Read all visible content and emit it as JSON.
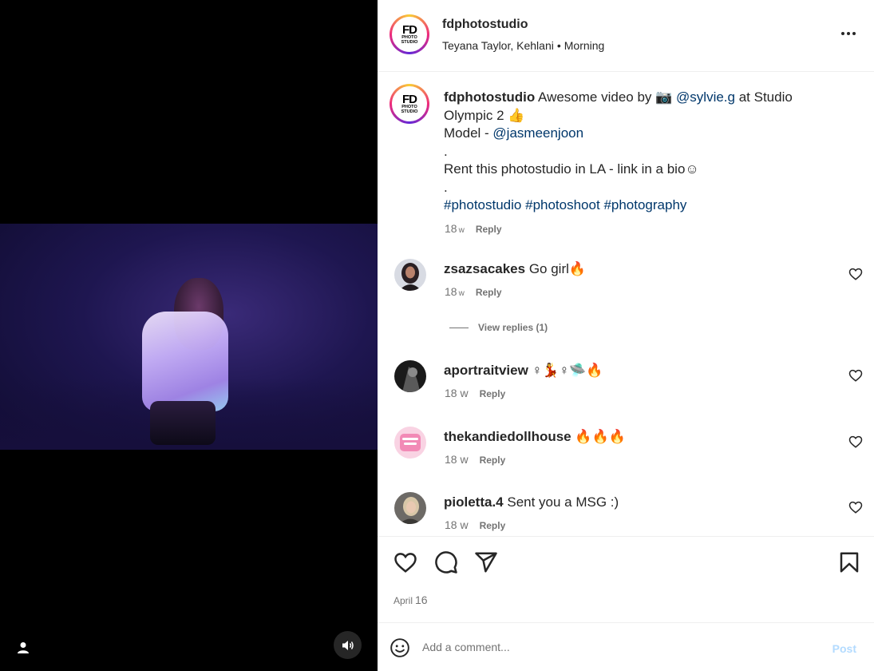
{
  "post": {
    "username": "fdphotostudio",
    "audio": "Teyana Taylor, Kehlani",
    "audio_sep": "•",
    "audio_track": "Morning",
    "avatar_text_big": "FD",
    "avatar_text_small_1": "PHOTO",
    "avatar_text_small_2": "STUDIO"
  },
  "caption": {
    "username": "fdphotostudio",
    "text_1": " Awesome video by 📷 ",
    "mention_1": "@sylvie.g",
    "text_2": " at Studio Olympic 2 👍",
    "model_label": "Model - ",
    "mention_2": "@jasmeenjoon",
    "dot_1": ".",
    "rent_text": "Rent this photostudio in LA - link in a bio☺",
    "dot_2": ".",
    "hashtags": [
      "#photostudio",
      "#photoshoot",
      "#photography"
    ],
    "time": "18",
    "time_unit": "w",
    "reply": "Reply"
  },
  "comments": [
    {
      "username": "zsazsacakes",
      "text": "Go girl🔥",
      "time": "18",
      "time_unit": "w",
      "reply": "Reply"
    },
    {
      "username": "aportraitview",
      "text": "♀💃♀🛸🔥",
      "time": "18 w",
      "reply": "Reply"
    },
    {
      "username": "thekandiedollhouse",
      "text": "🔥🔥🔥",
      "time": "18 w",
      "reply": "Reply"
    },
    {
      "username": "pioletta.4",
      "text": "Sent you a MSG :)",
      "time": "18 w",
      "reply": "Reply"
    }
  ],
  "view_replies": "View replies (1)",
  "date": {
    "month": "April",
    "day": "16"
  },
  "add_comment": {
    "placeholder": "Add a comment...",
    "post_label": "Post"
  },
  "colors": {
    "link": "#00376b",
    "muted": "#737373",
    "post_disabled": "#b3dbff",
    "video_bg": "#000000"
  },
  "icons": [
    "user-icon",
    "sound-on-icon",
    "more-options-icon",
    "heart-icon",
    "comment-icon",
    "share-icon",
    "bookmark-icon",
    "emoji-icon"
  ]
}
